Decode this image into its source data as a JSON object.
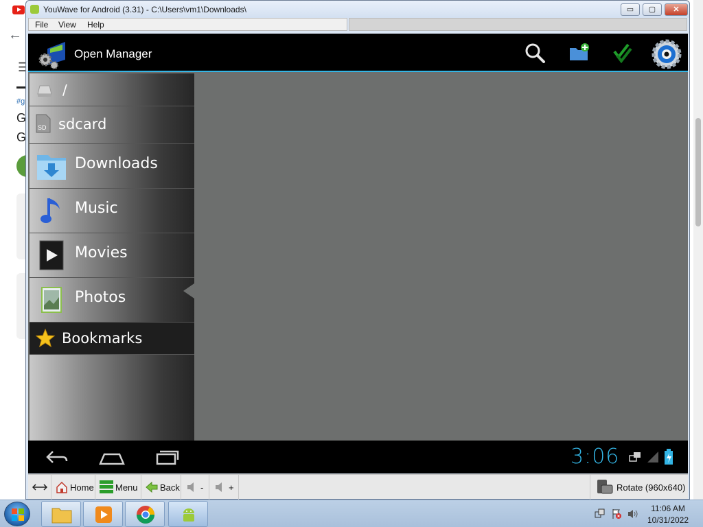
{
  "window": {
    "title": "YouWave for Android (3.31) - C:\\Users\\vm1\\Downloads\\",
    "min_label": "▭",
    "max_label": "▢",
    "close_label": "✕"
  },
  "menubar": {
    "file": "File",
    "view": "View",
    "help": "Help"
  },
  "app": {
    "title": "Open Manager",
    "actions": [
      "search-icon",
      "new-folder-icon",
      "select-icon",
      "settings-icon"
    ]
  },
  "drawer": {
    "items": [
      {
        "label": "/",
        "icon": "drive-icon"
      },
      {
        "label": "sdcard",
        "icon": "sd-icon"
      },
      {
        "label": "Downloads",
        "icon": "downloads-folder-icon"
      },
      {
        "label": "Music",
        "icon": "music-icon"
      },
      {
        "label": "Movies",
        "icon": "movies-icon"
      },
      {
        "label": "Photos",
        "icon": "photos-icon"
      },
      {
        "label": "Bookmarks",
        "icon": "star-icon"
      }
    ]
  },
  "statusbar": {
    "clock": "3:06"
  },
  "toolbar": {
    "home": "Home",
    "menu": "Menu",
    "back": "Back",
    "vol_down": "-",
    "vol_up": "+",
    "rotate": "Rotate (960x640)"
  },
  "taskbar": {
    "time": "11:06 AM",
    "date": "10/31/2022"
  },
  "background": {
    "text_g1": "G",
    "text_g2": "G",
    "tag": "#g"
  }
}
